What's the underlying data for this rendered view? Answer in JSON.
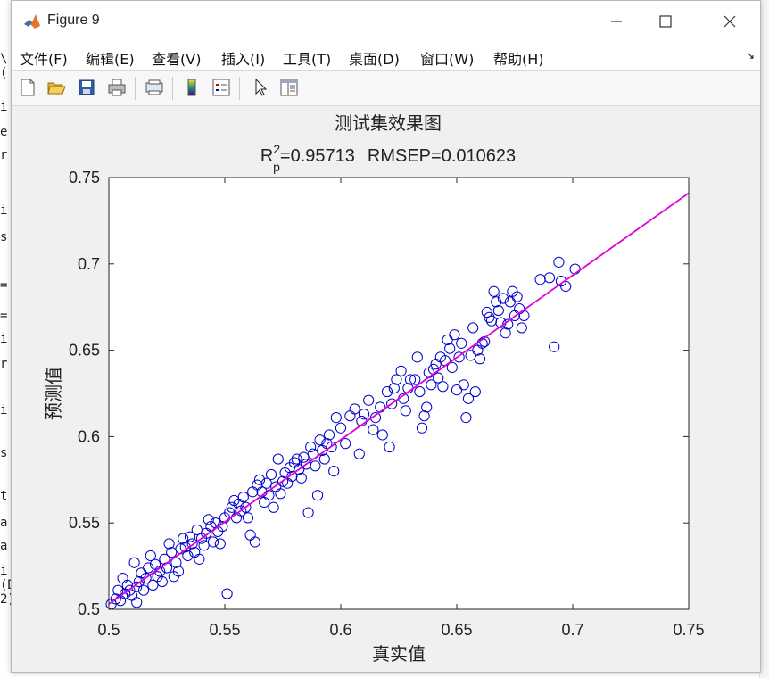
{
  "window": {
    "title": "Figure 9"
  },
  "menu": [
    "文件(F)",
    "编辑(E)",
    "查看(V)",
    "插入(I)",
    "工具(T)",
    "桌面(D)",
    "窗口(W)",
    "帮助(H)"
  ],
  "menu_overflow_icon": "arrow-icon",
  "toolbar": [
    "new-figure-icon",
    "open-file-icon",
    "save-icon",
    "print-icon",
    "link-plot-icon",
    "colorbar-icon",
    "legend-icon",
    "pointer-icon",
    "property-editor-icon"
  ],
  "editor_fragments": [
    "\\(",
    "i",
    "e",
    "r",
    "i",
    "s",
    "=",
    "=",
    "i",
    "r",
    "i",
    "s",
    "t",
    "a",
    "a",
    "i  (Dataaia 2)"
  ],
  "colors": {
    "points": "#0000cc",
    "fit_line": "#dd00dd",
    "axes": "#262626"
  },
  "chart_data": {
    "type": "scatter",
    "title": "测试集效果图",
    "subtitle": {
      "r_base": "R",
      "r_sup": "2",
      "r_sub": "p",
      "r_value": "=0.95713",
      "rmsep": "RMSEP=0.010623"
    },
    "xlabel": "真实值",
    "ylabel": "预测值",
    "xlim": [
      0.5,
      0.75
    ],
    "ylim": [
      0.5,
      0.75
    ],
    "xticks": [
      "0.5",
      "0.55",
      "0.6",
      "0.65",
      "0.7",
      "0.75"
    ],
    "yticks": [
      "0.5",
      "0.55",
      "0.6",
      "0.65",
      "0.7",
      "0.75"
    ],
    "fit_line": {
      "x": [
        0.5,
        0.75
      ],
      "y": [
        0.503,
        0.741
      ]
    },
    "series": [
      {
        "marker": "circle-open",
        "points": [
          [
            0.501,
            0.503
          ],
          [
            0.503,
            0.506
          ],
          [
            0.504,
            0.511
          ],
          [
            0.505,
            0.505
          ],
          [
            0.506,
            0.518
          ],
          [
            0.507,
            0.509
          ],
          [
            0.508,
            0.514
          ],
          [
            0.509,
            0.511
          ],
          [
            0.51,
            0.508
          ],
          [
            0.511,
            0.527
          ],
          [
            0.512,
            0.504
          ],
          [
            0.512,
            0.513
          ],
          [
            0.513,
            0.516
          ],
          [
            0.514,
            0.521
          ],
          [
            0.515,
            0.511
          ],
          [
            0.516,
            0.518
          ],
          [
            0.517,
            0.524
          ],
          [
            0.518,
            0.531
          ],
          [
            0.519,
            0.514
          ],
          [
            0.52,
            0.526
          ],
          [
            0.521,
            0.519
          ],
          [
            0.522,
            0.522
          ],
          [
            0.523,
            0.516
          ],
          [
            0.524,
            0.529
          ],
          [
            0.525,
            0.524
          ],
          [
            0.526,
            0.538
          ],
          [
            0.527,
            0.533
          ],
          [
            0.528,
            0.519
          ],
          [
            0.529,
            0.527
          ],
          [
            0.53,
            0.522
          ],
          [
            0.531,
            0.535
          ],
          [
            0.532,
            0.541
          ],
          [
            0.533,
            0.536
          ],
          [
            0.534,
            0.531
          ],
          [
            0.535,
            0.542
          ],
          [
            0.536,
            0.538
          ],
          [
            0.537,
            0.533
          ],
          [
            0.538,
            0.546
          ],
          [
            0.539,
            0.529
          ],
          [
            0.54,
            0.541
          ],
          [
            0.541,
            0.537
          ],
          [
            0.542,
            0.544
          ],
          [
            0.543,
            0.552
          ],
          [
            0.544,
            0.548
          ],
          [
            0.545,
            0.539
          ],
          [
            0.546,
            0.55
          ],
          [
            0.547,
            0.545
          ],
          [
            0.548,
            0.538
          ],
          [
            0.549,
            0.548
          ],
          [
            0.55,
            0.553
          ],
          [
            0.551,
            0.509
          ],
          [
            0.552,
            0.556
          ],
          [
            0.553,
            0.559
          ],
          [
            0.554,
            0.563
          ],
          [
            0.555,
            0.553
          ],
          [
            0.556,
            0.561
          ],
          [
            0.557,
            0.557
          ],
          [
            0.558,
            0.565
          ],
          [
            0.559,
            0.559
          ],
          [
            0.56,
            0.553
          ],
          [
            0.561,
            0.543
          ],
          [
            0.562,
            0.568
          ],
          [
            0.563,
            0.539
          ],
          [
            0.564,
            0.572
          ],
          [
            0.565,
            0.575
          ],
          [
            0.566,
            0.568
          ],
          [
            0.567,
            0.562
          ],
          [
            0.568,
            0.573
          ],
          [
            0.569,
            0.566
          ],
          [
            0.57,
            0.578
          ],
          [
            0.571,
            0.559
          ],
          [
            0.572,
            0.571
          ],
          [
            0.573,
            0.587
          ],
          [
            0.574,
            0.567
          ],
          [
            0.575,
            0.574
          ],
          [
            0.576,
            0.579
          ],
          [
            0.577,
            0.573
          ],
          [
            0.578,
            0.582
          ],
          [
            0.579,
            0.577
          ],
          [
            0.58,
            0.585
          ],
          [
            0.581,
            0.587
          ],
          [
            0.582,
            0.581
          ],
          [
            0.583,
            0.576
          ],
          [
            0.584,
            0.588
          ],
          [
            0.585,
            0.584
          ],
          [
            0.586,
            0.556
          ],
          [
            0.587,
            0.594
          ],
          [
            0.588,
            0.59
          ],
          [
            0.589,
            0.583
          ],
          [
            0.59,
            0.566
          ],
          [
            0.591,
            0.598
          ],
          [
            0.592,
            0.592
          ],
          [
            0.593,
            0.587
          ],
          [
            0.594,
            0.596
          ],
          [
            0.595,
            0.601
          ],
          [
            0.596,
            0.594
          ],
          [
            0.597,
            0.58
          ],
          [
            0.598,
            0.611
          ],
          [
            0.6,
            0.605
          ],
          [
            0.602,
            0.596
          ],
          [
            0.604,
            0.612
          ],
          [
            0.606,
            0.616
          ],
          [
            0.608,
            0.59
          ],
          [
            0.609,
            0.609
          ],
          [
            0.61,
            0.613
          ],
          [
            0.612,
            0.621
          ],
          [
            0.614,
            0.604
          ],
          [
            0.615,
            0.611
          ],
          [
            0.617,
            0.617
          ],
          [
            0.618,
            0.601
          ],
          [
            0.62,
            0.626
          ],
          [
            0.621,
            0.594
          ],
          [
            0.622,
            0.619
          ],
          [
            0.623,
            0.628
          ],
          [
            0.624,
            0.633
          ],
          [
            0.626,
            0.638
          ],
          [
            0.627,
            0.622
          ],
          [
            0.628,
            0.615
          ],
          [
            0.629,
            0.628
          ],
          [
            0.63,
            0.633
          ],
          [
            0.632,
            0.633
          ],
          [
            0.633,
            0.646
          ],
          [
            0.634,
            0.626
          ],
          [
            0.635,
            0.605
          ],
          [
            0.636,
            0.612
          ],
          [
            0.637,
            0.617
          ],
          [
            0.638,
            0.637
          ],
          [
            0.639,
            0.63
          ],
          [
            0.64,
            0.639
          ],
          [
            0.641,
            0.642
          ],
          [
            0.642,
            0.634
          ],
          [
            0.643,
            0.646
          ],
          [
            0.644,
            0.629
          ],
          [
            0.645,
            0.644
          ],
          [
            0.646,
            0.656
          ],
          [
            0.647,
            0.651
          ],
          [
            0.648,
            0.64
          ],
          [
            0.649,
            0.659
          ],
          [
            0.65,
            0.627
          ],
          [
            0.651,
            0.646
          ],
          [
            0.652,
            0.654
          ],
          [
            0.653,
            0.63
          ],
          [
            0.654,
            0.611
          ],
          [
            0.655,
            0.622
          ],
          [
            0.656,
            0.647
          ],
          [
            0.657,
            0.663
          ],
          [
            0.658,
            0.626
          ],
          [
            0.659,
            0.65
          ],
          [
            0.66,
            0.645
          ],
          [
            0.661,
            0.654
          ],
          [
            0.662,
            0.655
          ],
          [
            0.663,
            0.672
          ],
          [
            0.664,
            0.669
          ],
          [
            0.665,
            0.667
          ],
          [
            0.666,
            0.684
          ],
          [
            0.667,
            0.678
          ],
          [
            0.668,
            0.673
          ],
          [
            0.669,
            0.666
          ],
          [
            0.67,
            0.68
          ],
          [
            0.671,
            0.66
          ],
          [
            0.672,
            0.665
          ],
          [
            0.673,
            0.678
          ],
          [
            0.674,
            0.684
          ],
          [
            0.675,
            0.67
          ],
          [
            0.676,
            0.681
          ],
          [
            0.677,
            0.674
          ],
          [
            0.678,
            0.663
          ],
          [
            0.679,
            0.67
          ],
          [
            0.686,
            0.691
          ],
          [
            0.69,
            0.692
          ],
          [
            0.692,
            0.652
          ],
          [
            0.694,
            0.701
          ],
          [
            0.695,
            0.69
          ],
          [
            0.697,
            0.687
          ],
          [
            0.701,
            0.697
          ]
        ]
      }
    ]
  }
}
